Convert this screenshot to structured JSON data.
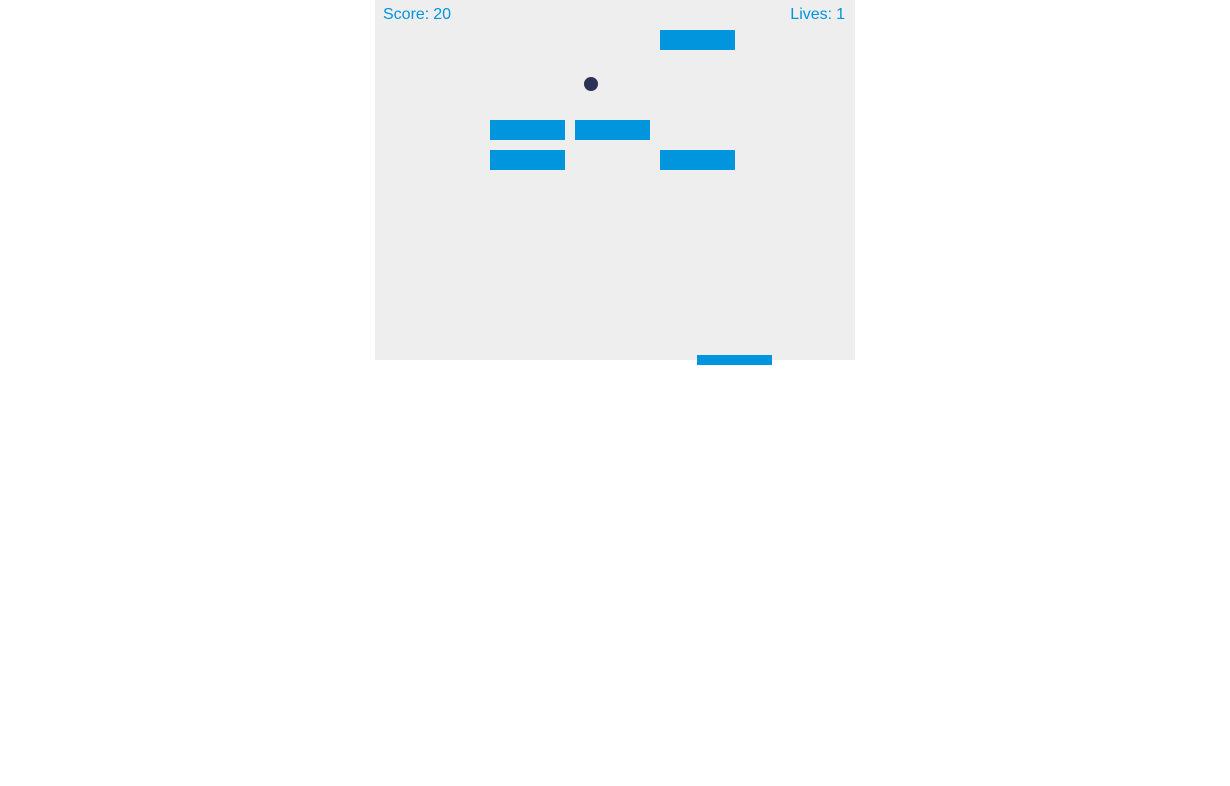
{
  "hud": {
    "score_label": "Score:",
    "score_value": "20",
    "lives_label": "Lives:",
    "lives_value": "1"
  },
  "colors": {
    "brick": "#0095dd",
    "paddle": "#0095dd",
    "ball": "#2c3158",
    "hud_text": "#0095dd",
    "canvas_bg": "#eeeeee"
  },
  "bricks": [
    {
      "row": 0,
      "col": 3
    },
    {
      "row": 3,
      "col": 1
    },
    {
      "row": 3,
      "col": 2
    },
    {
      "row": 4,
      "col": 1
    },
    {
      "row": 4,
      "col": 3
    }
  ]
}
